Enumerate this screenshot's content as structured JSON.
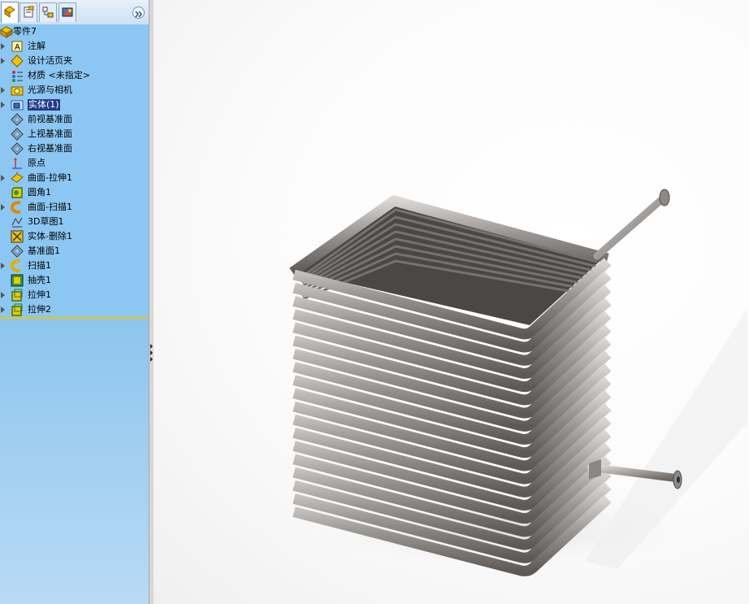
{
  "feature_manager": {
    "tabs": [
      {
        "name": "featuremanager-tab",
        "active": true
      },
      {
        "name": "propertymanager-tab",
        "active": false
      },
      {
        "name": "configurationmanager-tab",
        "active": false
      },
      {
        "name": "displaymanager-tab",
        "active": false
      }
    ],
    "root": {
      "label": "零件7",
      "icon": "part-icon"
    },
    "items": [
      {
        "label": "注解",
        "icon": "annotation-icon",
        "expandable": true
      },
      {
        "label": "设计活页夹",
        "icon": "design-binder-icon",
        "expandable": true
      },
      {
        "label": "材质 <未指定>",
        "icon": "material-icon",
        "expandable": false
      },
      {
        "label": "光源与相机",
        "icon": "lights-cameras-icon",
        "expandable": true
      },
      {
        "label": "实体(1)",
        "icon": "solid-bodies-icon",
        "expandable": true,
        "selected": true
      },
      {
        "label": "前视基准面",
        "icon": "plane-icon",
        "expandable": false
      },
      {
        "label": "上视基准面",
        "icon": "plane-icon",
        "expandable": false
      },
      {
        "label": "右视基准面",
        "icon": "plane-icon",
        "expandable": false
      },
      {
        "label": "原点",
        "icon": "origin-icon",
        "expandable": false
      },
      {
        "label": "曲面-拉伸1",
        "icon": "surface-extrude-icon",
        "expandable": true
      },
      {
        "label": "圆角1",
        "icon": "fillet-icon",
        "expandable": false
      },
      {
        "label": "曲面-扫描1",
        "icon": "surface-sweep-icon",
        "expandable": true
      },
      {
        "label": "3D草图1",
        "icon": "3d-sketch-icon",
        "expandable": false
      },
      {
        "label": "实体-删除1",
        "icon": "delete-body-icon",
        "expandable": false
      },
      {
        "label": "基准面1",
        "icon": "plane-icon",
        "expandable": false
      },
      {
        "label": "扫描1",
        "icon": "sweep-icon",
        "expandable": true
      },
      {
        "label": "抽壳1",
        "icon": "shell-icon",
        "expandable": false
      },
      {
        "label": "拉伸1",
        "icon": "extrude-icon",
        "expandable": true
      },
      {
        "label": "拉伸2",
        "icon": "extrude-icon",
        "expandable": true
      }
    ]
  },
  "colors": {
    "panel_bg": "#8cc7f3",
    "selection": "#243a8c",
    "tree_bottom_border": "#f2c400",
    "model_metal": "#8f8b88"
  },
  "viewport": {
    "model_description_icon": "coiled-tube-heat-exchanger-model"
  }
}
